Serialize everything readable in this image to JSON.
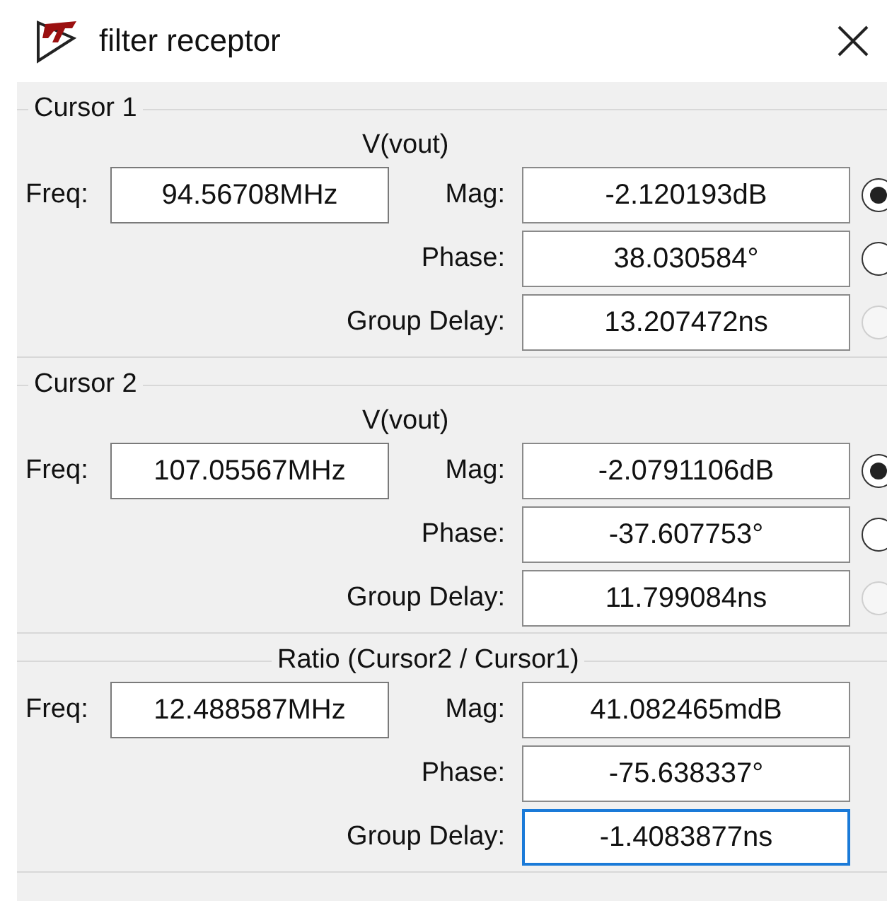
{
  "window": {
    "title": "filter receptor"
  },
  "sections": [
    {
      "kind": "cursor",
      "title": "Cursor 1",
      "trace": "V(vout)",
      "freq_label": "Freq:",
      "freq": "94.56708MHz",
      "rows": [
        {
          "label": "Mag:",
          "value": "-2.120193dB",
          "focused": false,
          "radio": {
            "selected": true,
            "disabled": false
          }
        },
        {
          "label": "Phase:",
          "value": "38.030584°",
          "focused": false,
          "radio": {
            "selected": false,
            "disabled": false
          }
        },
        {
          "label": "Group Delay:",
          "value": "13.207472ns",
          "focused": false,
          "radio": {
            "selected": false,
            "disabled": true
          }
        }
      ]
    },
    {
      "kind": "cursor",
      "title": "Cursor 2",
      "trace": "V(vout)",
      "freq_label": "Freq:",
      "freq": "107.05567MHz",
      "rows": [
        {
          "label": "Mag:",
          "value": "-2.0791106dB",
          "focused": false,
          "radio": {
            "selected": true,
            "disabled": false
          }
        },
        {
          "label": "Phase:",
          "value": "-37.607753°",
          "focused": false,
          "radio": {
            "selected": false,
            "disabled": false
          }
        },
        {
          "label": "Group Delay:",
          "value": "11.799084ns",
          "focused": false,
          "radio": {
            "selected": false,
            "disabled": true
          }
        }
      ]
    },
    {
      "kind": "ratio",
      "title": "Ratio (Cursor2 / Cursor1)",
      "freq_label": "Freq:",
      "freq": "12.488587MHz",
      "rows": [
        {
          "label": "Mag:",
          "value": "41.082465mdB",
          "focused": false
        },
        {
          "label": "Phase:",
          "value": "-75.638337°",
          "focused": false
        },
        {
          "label": "Group Delay:",
          "value": "-1.4083877ns",
          "focused": true
        }
      ]
    }
  ]
}
